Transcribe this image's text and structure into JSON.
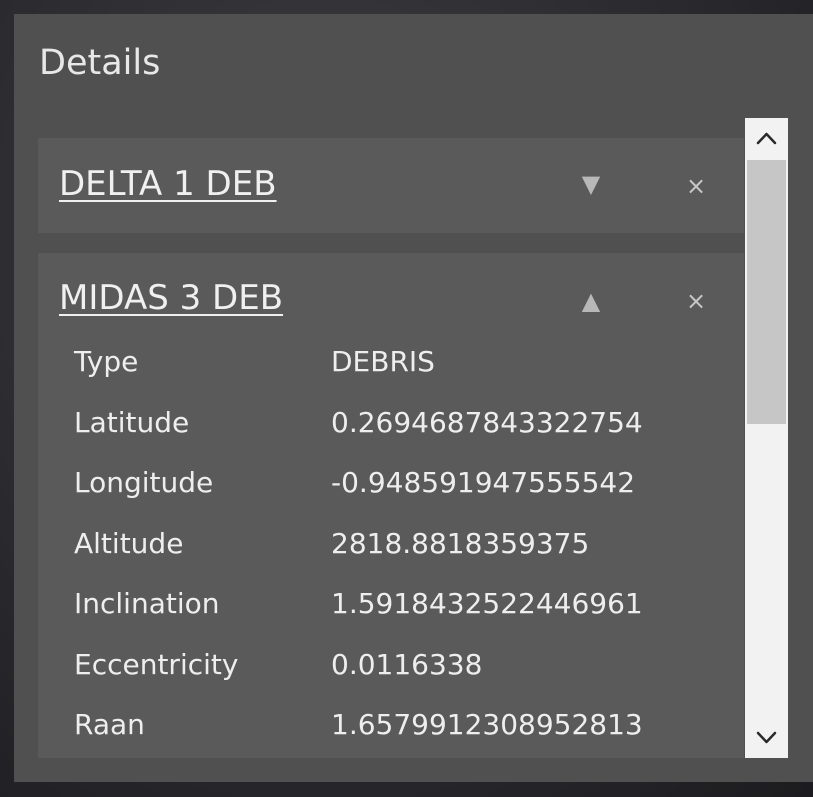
{
  "panel": {
    "title": "Details"
  },
  "cards": [
    {
      "title": "DELTA 1 DEB",
      "toggle_glyph": "▼",
      "close_glyph": "×",
      "expanded": false
    },
    {
      "title": "MIDAS 3 DEB",
      "toggle_glyph": "▲",
      "close_glyph": "×",
      "expanded": true,
      "properties": [
        {
          "label": "Type",
          "value": "DEBRIS"
        },
        {
          "label": "Latitude",
          "value": "0.2694687843322754"
        },
        {
          "label": "Longitude",
          "value": "-0.948591947555542"
        },
        {
          "label": "Altitude",
          "value": "2818.8818359375"
        },
        {
          "label": "Inclination",
          "value": "1.5918432522446961"
        },
        {
          "label": "Eccentricity",
          "value": "0.0116338"
        },
        {
          "label": "Raan",
          "value": "1.6579912308952813"
        }
      ]
    }
  ],
  "icons": {
    "collapsed_toggle": "triangle-down-icon",
    "expanded_toggle": "triangle-up-icon",
    "close": "close-icon",
    "scroll_up": "chevron-up-icon",
    "scroll_down": "chevron-down-icon"
  },
  "colors": {
    "panel_bg": "#505050",
    "card_bg": "#5b5a5a",
    "text": "#eeeeee",
    "scrollbar_track": "#f2f2f2",
    "scrollbar_thumb": "#c6c6c6"
  }
}
